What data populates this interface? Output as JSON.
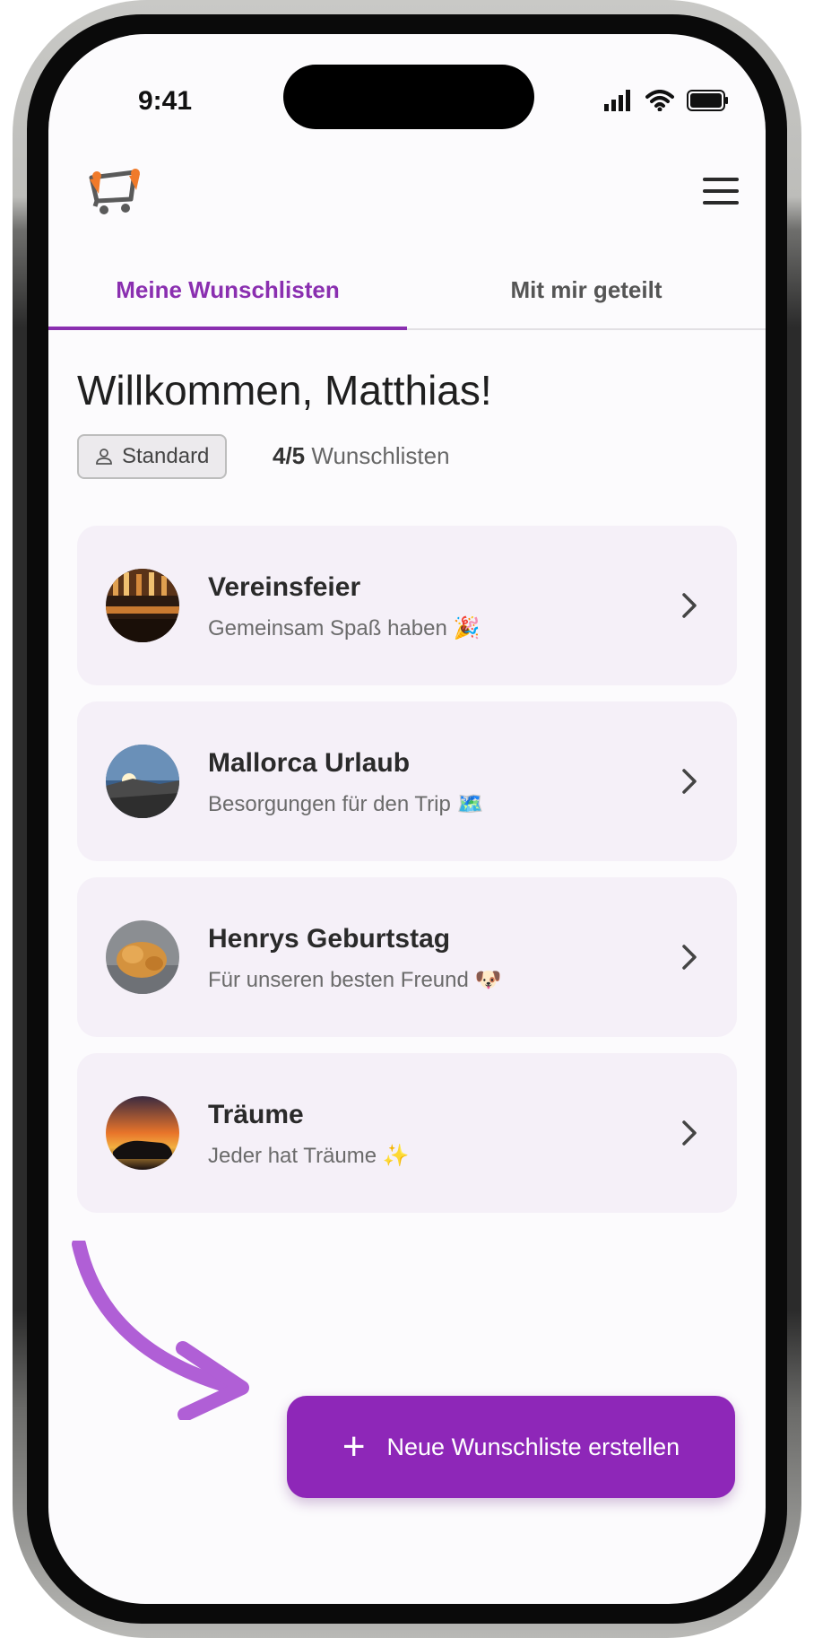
{
  "status_bar": {
    "time": "9:41"
  },
  "tabs": [
    {
      "label": "Meine Wunschlisten",
      "active": true
    },
    {
      "label": "Mit mir geteilt",
      "active": false
    }
  ],
  "welcome": {
    "text": "Willkommen, Matthias!"
  },
  "plan": {
    "badge_label": "Standard",
    "count": "4/5",
    "count_suffix": "Wunschlisten"
  },
  "wishlists": [
    {
      "title": "Vereinsfeier",
      "subtitle": "Gemeinsam Spaß haben 🎉"
    },
    {
      "title": "Mallorca Urlaub",
      "subtitle": "Besorgungen für den Trip 🗺️"
    },
    {
      "title": "Henrys Geburtstag",
      "subtitle": "Für unseren besten Freund 🐶"
    },
    {
      "title": "Träume",
      "subtitle": "Jeder hat Träume ✨"
    }
  ],
  "create_button": {
    "label": "Neue Wunschliste erstellen",
    "icon": "plus-icon"
  },
  "colors": {
    "accent": "#8e27b8",
    "card_bg": "#f5f0f8",
    "arrow": "#b05fd6"
  }
}
